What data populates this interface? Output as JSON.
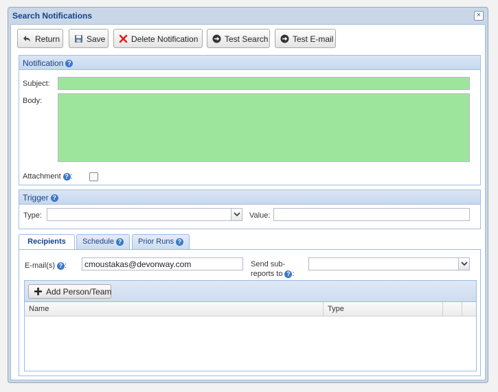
{
  "dialog": {
    "title": "Search Notifications"
  },
  "toolbar": {
    "return_label": "Return",
    "save_label": "Save",
    "delete_label": "Delete Notification",
    "test_search_label": "Test Search",
    "test_email_label": "Test E-mail"
  },
  "notification": {
    "header": "Notification",
    "subject_label": "Subject:",
    "subject_value": "",
    "body_label": "Body:",
    "body_value": "",
    "attachment_label": "Attachment",
    "attachment_suffix": ":",
    "attachment_checked": false
  },
  "trigger": {
    "header": "Trigger",
    "type_label": "Type:",
    "type_value": "",
    "value_label": "Value:",
    "value_value": ""
  },
  "tabs": [
    {
      "label": "Recipients",
      "active": true
    },
    {
      "label": "Schedule",
      "active": false
    },
    {
      "label": "Prior Runs",
      "active": false
    }
  ],
  "recipients": {
    "emails_label": "E-mail(s)",
    "emails_suffix": ":",
    "emails_value": "cmoustakas@devonway.com",
    "send_sub_label_1": "Send sub-",
    "send_sub_label_2": "reports to",
    "send_sub_suffix": ":",
    "send_sub_value": "",
    "add_person_label": "Add Person/Team",
    "columns": [
      "Name",
      "Type"
    ]
  },
  "colors": {
    "field_green": "#9de59d",
    "accent_blue": "#15428b",
    "help_icon": "#3b78c6",
    "delete_red": "#d9201b"
  }
}
